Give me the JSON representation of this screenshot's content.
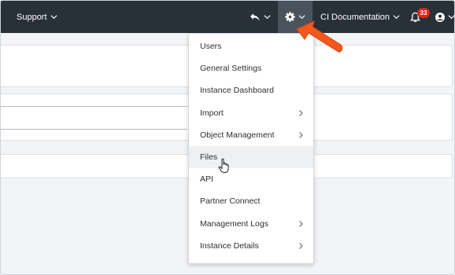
{
  "nav": {
    "support_label": "Support",
    "docs_label": "CI Documentation",
    "notification_count": "33",
    "icons": [
      "undo-icon",
      "gear-icon",
      "bell-icon",
      "user-icon",
      "chevron-down-icon"
    ]
  },
  "settings_menu": {
    "items": [
      {
        "label": "Users",
        "has_submenu": false
      },
      {
        "label": "General Settings",
        "has_submenu": false
      },
      {
        "label": "Instance Dashboard",
        "has_submenu": false
      },
      {
        "label": "Import",
        "has_submenu": true
      },
      {
        "label": "Object Management",
        "has_submenu": true
      },
      {
        "label": "Files",
        "has_submenu": false,
        "hovered": true
      },
      {
        "label": "API",
        "has_submenu": false
      },
      {
        "label": "Partner Connect",
        "has_submenu": false
      },
      {
        "label": "Management Logs",
        "has_submenu": true
      },
      {
        "label": "Instance Details",
        "has_submenu": true
      }
    ]
  },
  "colors": {
    "navbar": "#283038",
    "active_nav_item": "#4a535c",
    "badge": "#e0231c",
    "callout_arrow": "#f2571e"
  }
}
